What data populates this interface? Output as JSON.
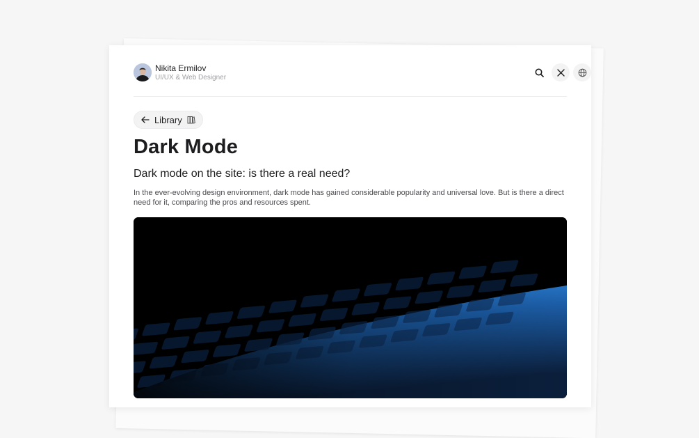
{
  "author": {
    "name": "Nikita Ermilov",
    "role": "UI/UX & Web Designer"
  },
  "header": {
    "icons": [
      "search-icon",
      "x-logo-icon",
      "globe-icon"
    ]
  },
  "nav": {
    "library_label": "Library",
    "back_icon": "arrow-left-icon",
    "library_icon": "books-icon"
  },
  "article": {
    "title": "Dark Mode",
    "subtitle": "Dark mode on the site: is there a real need?",
    "description": "In the ever-evolving design environment, dark mode has gained considerable popularity and universal love. But is there a direct need for it, comparing the pros and resources spent."
  },
  "colors": {
    "page_bg": "#f6f6f6",
    "card_bg": "#ffffff",
    "text": "#1d1d1f",
    "muted": "#a0a0a5",
    "accent_blue": "#1f6fd1"
  }
}
